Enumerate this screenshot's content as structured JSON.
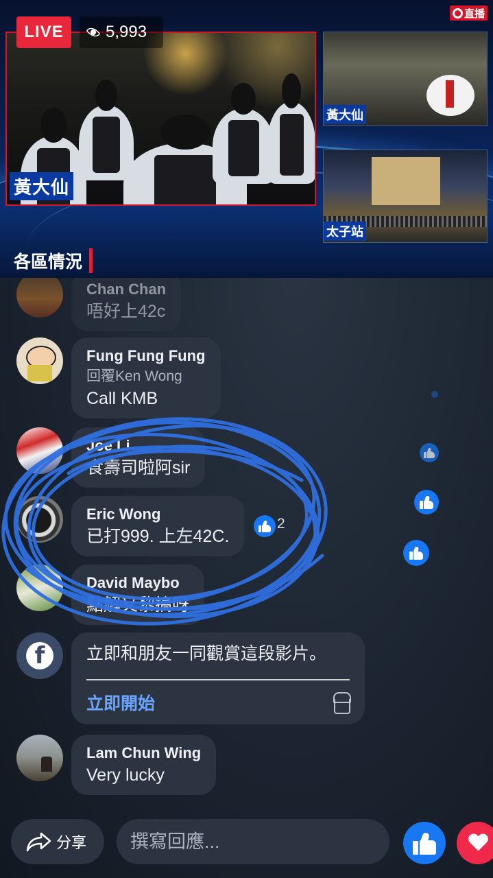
{
  "video": {
    "live_label": "LIVE",
    "viewer_count": "5,993",
    "channel_logo_text": "直播",
    "main_location": "黃大仙",
    "side_feeds": [
      {
        "location": "黃大仙"
      },
      {
        "location": "太子站"
      }
    ],
    "district_title": "各區情況"
  },
  "comments": [
    {
      "name": "Chan Chan",
      "text": "唔好上42c"
    },
    {
      "name": "Fung  Fung Fung",
      "reply_to": "回覆Ken Wong",
      "text": "Call KMB"
    },
    {
      "name": "Joe Li",
      "text": "食壽司啦阿sir"
    },
    {
      "name": "Eric Wong",
      "text": "已打999. 上左42C.",
      "like_count": "2"
    },
    {
      "name": "David Maybo",
      "text": "點解又黎搞呀"
    }
  ],
  "watch_together": {
    "text": "立即和朋友一同觀賞這段影片。",
    "start_label": "立即開始"
  },
  "last_comment": {
    "name": "Lam Chun Wing",
    "text": "Very lucky"
  },
  "bottom_bar": {
    "share_label": "分享",
    "reply_placeholder": "撰寫回應..."
  },
  "colors": {
    "live_red": "#e8283a",
    "facebook_blue": "#1877f2",
    "love_red": "#f02849",
    "link_blue": "#6aa6ff",
    "annotation_blue": "#2f6fe0"
  },
  "annotation": {
    "type": "hand-drawn circle",
    "color": "#2f6fe0"
  }
}
